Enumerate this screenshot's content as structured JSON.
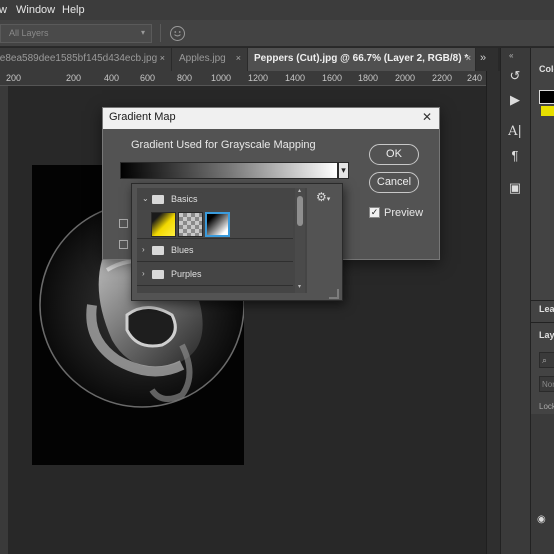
{
  "menu": {
    "items": [
      "w",
      "Window",
      "Help"
    ]
  },
  "options_bar": {
    "layers_select": "All Layers"
  },
  "tabs": [
    {
      "label": "fe8ea589dee1585bf145d434ecb.jpg",
      "active": false
    },
    {
      "label": "Apples.jpg",
      "active": false
    },
    {
      "label": "Peppers (Cut).jpg @ 66.7% (Layer 2, RGB/8) *",
      "active": true
    }
  ],
  "tab_close_glyph": "×",
  "ruler": {
    "labels": [
      "200",
      "200",
      "400",
      "600",
      "800",
      "1000",
      "1200",
      "1400",
      "1600",
      "1800",
      "2000",
      "2200",
      "240"
    ]
  },
  "dialog": {
    "title": "Gradient Map",
    "close_glyph": "✕",
    "group_label": "Gradient Used for Grayscale Mapping",
    "ok_label": "OK",
    "cancel_label": "Cancel",
    "preview_label": "Preview",
    "preview_checked": true
  },
  "gradient_picker": {
    "groups": [
      {
        "name": "Basics",
        "expanded": true
      },
      {
        "name": "Blues",
        "expanded": false
      },
      {
        "name": "Purples",
        "expanded": false
      }
    ],
    "swatches": [
      "foreground-to-background",
      "foreground-to-transparent",
      "black-white"
    ],
    "selected_swatch": "black-white"
  },
  "side_panel": {
    "labels": [
      "Colo",
      "Lea",
      "Lay",
      "Nor",
      "Lock"
    ]
  },
  "icons": {
    "smile": "smile-icon",
    "gear": "gear-icon",
    "tabs_more": "double-chevron-right-icon"
  },
  "colors": {
    "accent": "#3a9bdc",
    "dialog_bg": "#535353",
    "canvas_bg": "#282828"
  }
}
